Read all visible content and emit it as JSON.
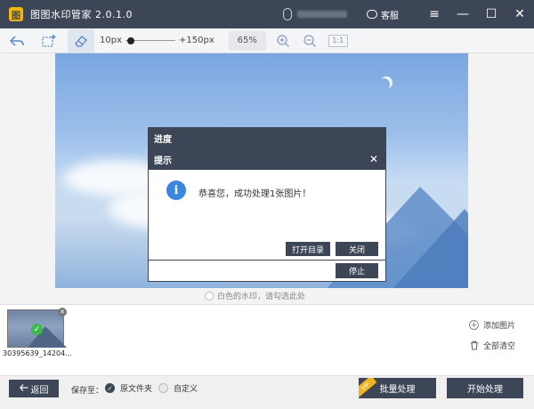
{
  "app": {
    "title": "图图水印管家  2.0.1.0",
    "service_label": "客服",
    "minimize": "—",
    "maximize": "☐",
    "close": "✕",
    "menu": "≡"
  },
  "toolbar": {
    "size_min": "10px",
    "size_max": "+150px",
    "brush_size_fraction": 0.05,
    "zoom": "65%",
    "ratio": "1:1"
  },
  "canvas": {
    "hint": "白色的水印，请勾选此处"
  },
  "dialog_progress": {
    "title": "进度",
    "stop": "停止"
  },
  "dialog_info": {
    "title": "提示",
    "icon": "i",
    "message": "恭喜您，成功处理1张图片！",
    "open_dir": "打开目录",
    "close": "关闭"
  },
  "thumbnails": [
    {
      "name": "30395639_14204...",
      "status": "done"
    }
  ],
  "side_actions": {
    "add_image": "添加图片",
    "clear_all": "全部清空"
  },
  "bottom": {
    "back": "返回",
    "save_to": "保存至：",
    "option_source": "原文件夹",
    "option_custom": "自定义",
    "vip": "VIP",
    "batch": "批量处理",
    "start": "开始处理"
  },
  "colors": {
    "primary": "#3d4656",
    "accent_blue": "#3a86e0",
    "success_green": "#3cb94a",
    "vip_gold": "#f0b41c"
  }
}
